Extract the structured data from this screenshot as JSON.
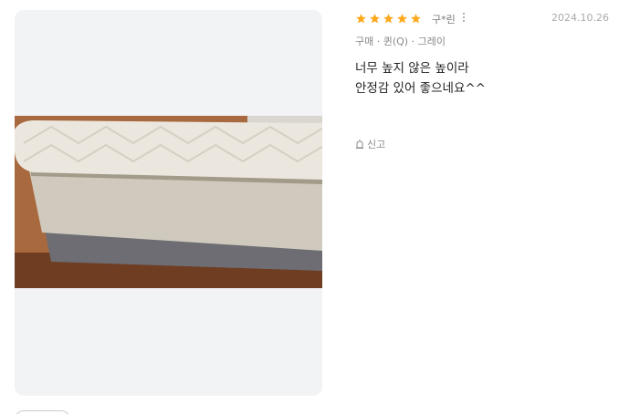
{
  "review": {
    "rating": 5,
    "rating_max": 5,
    "reviewer": "구*린",
    "date": "2024.10.26",
    "option": "구매 · 퀸(Q) · 그레이",
    "text": "너무 높지 않은 높이라\n안정감 있어 좋으네요^^",
    "report_label": "신고"
  },
  "photo": {
    "subject": "mattress-on-gray-base-photo"
  },
  "colors": {
    "star": "#ffa91f",
    "card_bg": "#f2f3f5"
  }
}
